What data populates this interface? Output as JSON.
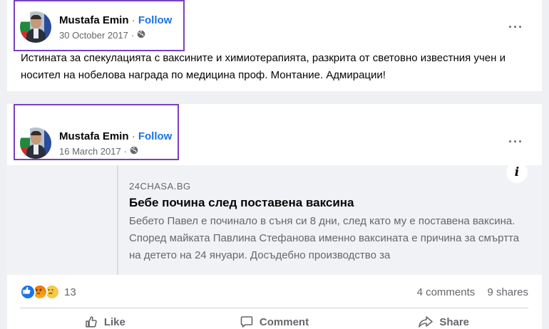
{
  "posts": [
    {
      "author": "Mustafa Emin",
      "follow": "Follow",
      "separator": "·",
      "date": "30 October 2017",
      "text": "Истината за спекулацията с ваксините и  химиотерапията, разкрита от световно известния учен и носител на нобелова награда по медицина проф. Монтание. Адмирации!"
    },
    {
      "author": "Mustafa Emin",
      "follow": "Follow",
      "separator": "·",
      "date": "16 March 2017",
      "link": {
        "domain": "24CHASA.BG",
        "title": "Бебе почина след поставена ваксина",
        "description": "Бебето Павел е починало в съня си 8 дни, след като му е поставена ваксина. Според майката Павлина Стефанова именно ваксината е причина за смъртта на детето на 24 януари. Досъдебно производство за"
      },
      "reactions_count": "13",
      "comments": "4 comments",
      "shares": "9 shares",
      "actions": {
        "like": "Like",
        "comment": "Comment",
        "share": "Share"
      }
    }
  ],
  "more_icon": "···",
  "info_icon": "i",
  "icons": [
    "globe-icon",
    "more-options-icon",
    "info-icon",
    "like-icon",
    "comment-icon",
    "share-icon"
  ],
  "colors": {
    "follow": "#1b74e4",
    "highlight": "#7b3fc2",
    "like_react": "#1b74e4",
    "angry_react": "#e9710f",
    "sad_react": "#f7c948"
  }
}
